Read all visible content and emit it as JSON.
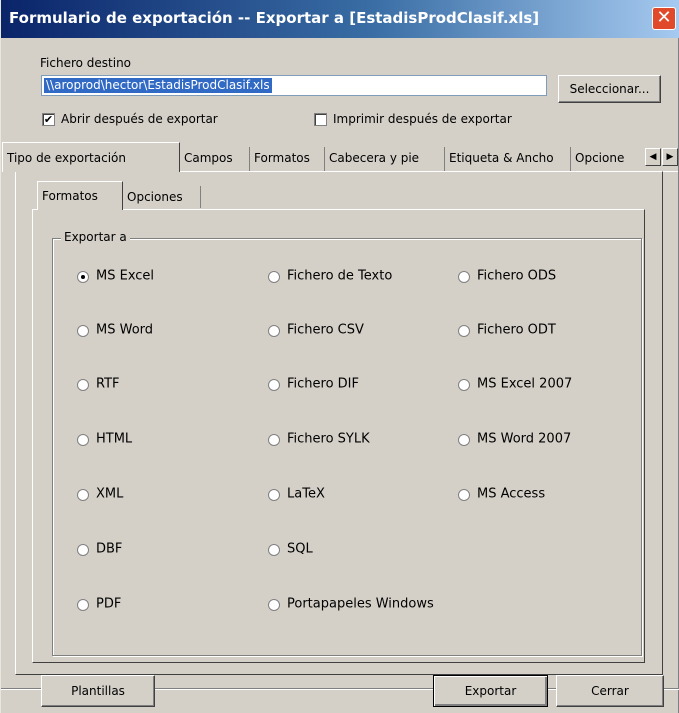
{
  "window": {
    "title": "Formulario de exportación -- Exportar a [EstadisProdClasif.xls]",
    "close_glyph": "✕"
  },
  "destination": {
    "label": "Fichero destino",
    "path": "\\\\aroprod\\hector\\EstadisProdClasif.xls",
    "select_button": "Seleccionar..."
  },
  "options": {
    "open_after": {
      "label": "Abrir después de exportar",
      "checked": true
    },
    "print_after": {
      "label": "Imprimir después de exportar",
      "checked": false
    }
  },
  "tabs": [
    {
      "label": "Tipo de exportación",
      "active": true
    },
    {
      "label": "Campos",
      "active": false
    },
    {
      "label": "Formatos",
      "active": false
    },
    {
      "label": "Cabecera y pie",
      "active": false
    },
    {
      "label": "Etiqueta & Ancho",
      "active": false
    },
    {
      "label": "Opcione",
      "active": false
    }
  ],
  "tab_scroll": {
    "left_icon": "triangle-left-icon",
    "right_icon": "triangle-right-icon"
  },
  "subtabs": [
    {
      "label": "Formatos",
      "active": true
    },
    {
      "label": "Opciones",
      "active": false
    }
  ],
  "export_group": {
    "title": "Exportar a",
    "formats": [
      {
        "label": "MS Excel",
        "checked": true
      },
      {
        "label": "Fichero de Texto",
        "checked": false
      },
      {
        "label": "Fichero ODS",
        "checked": false
      },
      {
        "label": "MS Word",
        "checked": false
      },
      {
        "label": "Fichero CSV",
        "checked": false
      },
      {
        "label": "Fichero ODT",
        "checked": false
      },
      {
        "label": "RTF",
        "checked": false
      },
      {
        "label": "Fichero DIF",
        "checked": false
      },
      {
        "label": "MS Excel 2007",
        "checked": false
      },
      {
        "label": "HTML",
        "checked": false
      },
      {
        "label": "Fichero SYLK",
        "checked": false
      },
      {
        "label": "MS Word 2007",
        "checked": false
      },
      {
        "label": "XML",
        "checked": false
      },
      {
        "label": "LaTeX",
        "checked": false
      },
      {
        "label": "MS Access",
        "checked": false
      },
      {
        "label": "DBF",
        "checked": false
      },
      {
        "label": "SQL",
        "checked": false
      },
      {
        "label": "PDF",
        "checked": false
      },
      {
        "label": "Portapapeles Windows",
        "checked": false
      }
    ]
  },
  "footer": {
    "templates_button": "Plantillas",
    "export_button": "Exportar",
    "close_button": "Cerrar"
  }
}
